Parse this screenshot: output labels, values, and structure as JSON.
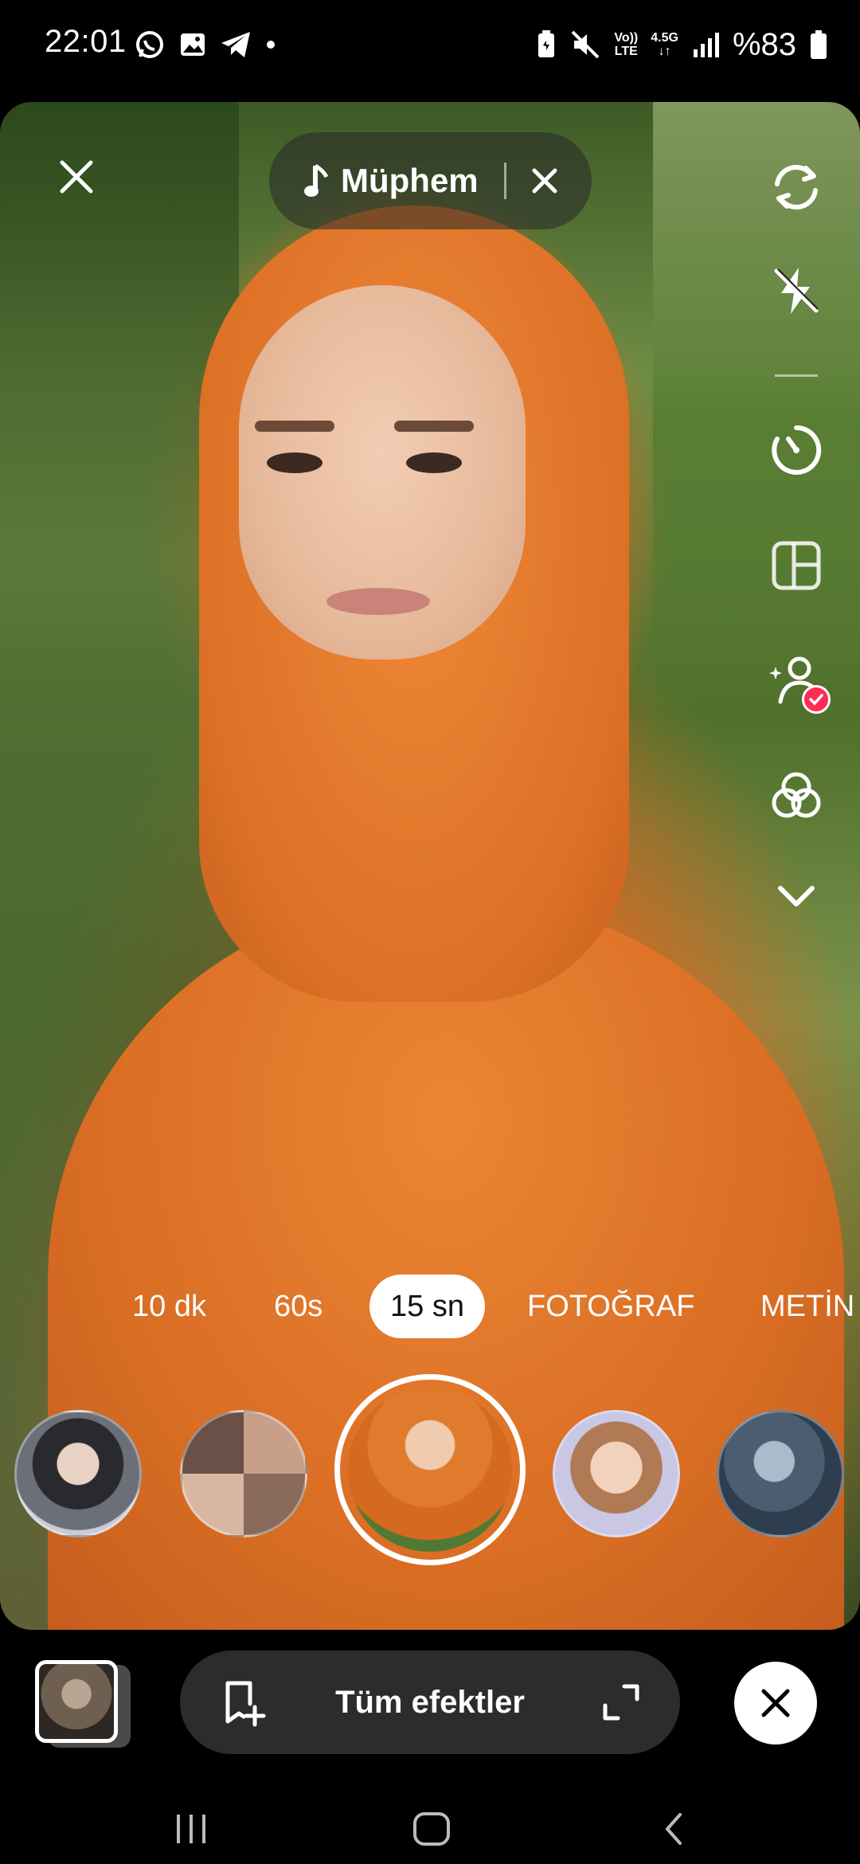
{
  "status_bar": {
    "time": "22:01",
    "network_top": "Vo))",
    "network_bottom": "LTE",
    "data_type_top": "4.5G",
    "data_type_bottom": "↓↑",
    "battery": "%83",
    "left_icons": [
      "whatsapp-icon",
      "gallery-icon",
      "telegram-icon",
      "dot-icon"
    ],
    "right_icons": [
      "battery-saver-icon",
      "mute-icon",
      "signal-icon",
      "battery-icon"
    ]
  },
  "top": {
    "close_icon": "close-icon",
    "music_title": "Müphem",
    "music_icon": "music-note-icon",
    "music_close_icon": "close-icon"
  },
  "side_tools": [
    {
      "name": "flip-camera",
      "icon": "flip-camera-icon"
    },
    {
      "name": "flash-off",
      "icon": "flash-off-icon"
    },
    {
      "name": "timer",
      "icon": "timer-icon"
    },
    {
      "name": "layout",
      "icon": "layout-grid-icon"
    },
    {
      "name": "beauty",
      "icon": "beauty-person-icon",
      "badge": "checked"
    },
    {
      "name": "filters",
      "icon": "filters-icon"
    },
    {
      "name": "expand",
      "icon": "chevron-down-icon"
    }
  ],
  "modes": [
    {
      "label": "10 dk",
      "active": false
    },
    {
      "label": "60s",
      "active": false
    },
    {
      "label": "15 sn",
      "active": true
    },
    {
      "label": "FOTOĞRAF",
      "active": false
    },
    {
      "label": "METİN",
      "active": false
    }
  ],
  "effects": {
    "selected_index": 2,
    "count": 5
  },
  "bottom": {
    "effects_label": "Tüm efektler",
    "effects_left_icon": "bookmark-add-icon",
    "effects_right_icon": "expand-icon",
    "close_icon": "close-icon",
    "gallery_icon": "gallery-thumbnail"
  },
  "nav": {
    "recents_icon": "recents-icon",
    "home_icon": "home-icon",
    "back_icon": "back-icon"
  },
  "colors": {
    "accent_pink": "#fe2c55",
    "pill_dark": "#2c2c2c"
  }
}
